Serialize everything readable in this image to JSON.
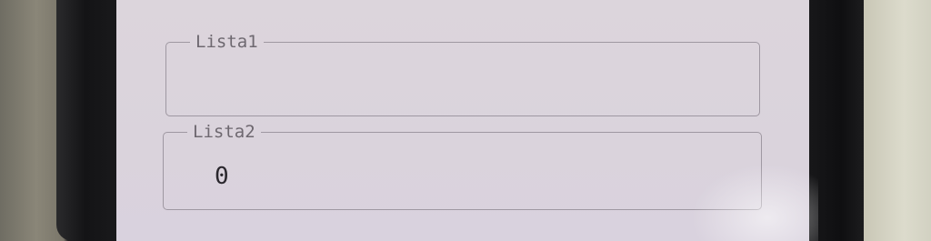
{
  "lists": [
    {
      "label": "Lista1",
      "value": ""
    },
    {
      "label": "Lista2",
      "value": "0"
    }
  ]
}
